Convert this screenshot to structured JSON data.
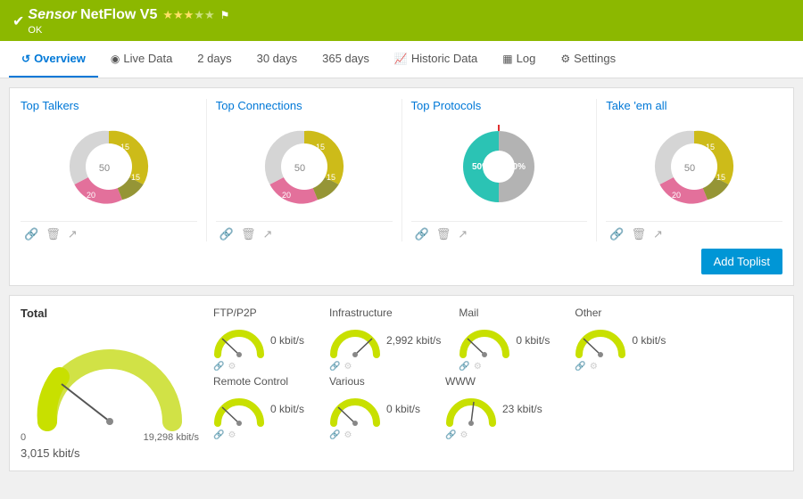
{
  "header": {
    "check": "✔",
    "title_italic": "Sensor",
    "title": "NetFlow V5",
    "flag_icon": "⚑",
    "stars": [
      true,
      true,
      true,
      false,
      false
    ],
    "status": "OK"
  },
  "tabs": [
    {
      "id": "overview",
      "label": "Overview",
      "icon": "↺",
      "active": true
    },
    {
      "id": "live-data",
      "label": "Live Data",
      "icon": "◉"
    },
    {
      "id": "2days",
      "label": "2  days"
    },
    {
      "id": "30days",
      "label": "30 days"
    },
    {
      "id": "365days",
      "label": "365 days"
    },
    {
      "id": "historic-data",
      "label": "Historic Data",
      "icon": "📈"
    },
    {
      "id": "log",
      "label": "Log",
      "icon": "▦"
    },
    {
      "id": "settings",
      "label": "Settings",
      "icon": "⚙"
    }
  ],
  "charts": [
    {
      "id": "top-talkers",
      "title": "Top Talkers",
      "segments": [
        {
          "color": "#c8b400",
          "pct": 15,
          "startAngle": 0
        },
        {
          "color": "#a0a040",
          "pct": 15,
          "startAngle": 54
        },
        {
          "color": "#e06090",
          "pct": 20,
          "startAngle": 108
        },
        {
          "color": "#f0a0b0",
          "pct": 50,
          "startAngle": 180
        }
      ],
      "center_label": "50"
    },
    {
      "id": "top-connections",
      "title": "Top Connections",
      "segments": [
        {
          "color": "#c8b400",
          "pct": 15,
          "startAngle": 0
        },
        {
          "color": "#a0a040",
          "pct": 15,
          "startAngle": 54
        },
        {
          "color": "#e06090",
          "pct": 20,
          "startAngle": 108
        },
        {
          "color": "#f0a0b0",
          "pct": 50,
          "startAngle": 180
        }
      ],
      "center_label": "50"
    },
    {
      "id": "top-protocols",
      "title": "Top Protocols",
      "segments": [
        {
          "color": "#20c0b0",
          "pct": 50,
          "startAngle": 0
        },
        {
          "color": "#a0a0a0",
          "pct": 50,
          "startAngle": 180
        }
      ],
      "center_label": "50%",
      "center_label2": "50%",
      "accent_line": true
    },
    {
      "id": "take-em-all",
      "title": "Take 'em all",
      "segments": [
        {
          "color": "#c8b400",
          "pct": 15,
          "startAngle": 0
        },
        {
          "color": "#a0a040",
          "pct": 15,
          "startAngle": 54
        },
        {
          "color": "#e06090",
          "pct": 20,
          "startAngle": 108
        },
        {
          "color": "#f0a0b0",
          "pct": 50,
          "startAngle": 180
        }
      ],
      "center_label": "50"
    }
  ],
  "chart_icons": [
    "🔗",
    "🗑",
    "↗"
  ],
  "add_toplist_label": "Add Toplist",
  "bottom": {
    "total_label": "Total",
    "total_value": "3,015 kbit/s",
    "gauge_min": "0",
    "gauge_max": "19,298 kbit/s",
    "gauges": [
      [
        {
          "label": "FTP/P2P",
          "value": "0 kbit/s"
        },
        {
          "label": "Infrastructure",
          "value": "2,992 kbit/s"
        },
        {
          "label": "Mail",
          "value": "0 kbit/s"
        },
        {
          "label": "Other",
          "value": "0 kbit/s"
        }
      ],
      [
        {
          "label": "Remote Control",
          "value": "0 kbit/s"
        },
        {
          "label": "Various",
          "value": "0 kbit/s"
        },
        {
          "label": "WWW",
          "value": "23 kbit/s"
        },
        {
          "label": "",
          "value": ""
        }
      ]
    ]
  }
}
